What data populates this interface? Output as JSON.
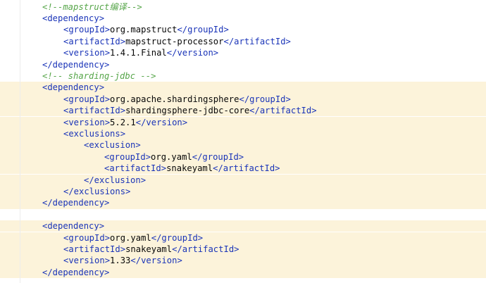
{
  "editor": {
    "colors": {
      "tag": "#1a34b8",
      "text": "#080808",
      "comment": "#57a64a",
      "highlight": "#fcf3da"
    },
    "lines": [
      {
        "highlight": false,
        "parts": [
          {
            "t": "cm",
            "v": "<!--mapstruct编译-->"
          }
        ]
      },
      {
        "highlight": false,
        "parts": [
          {
            "t": "tag",
            "v": "<dependency>"
          }
        ]
      },
      {
        "highlight": false,
        "parts": [
          {
            "t": "tag",
            "v": "<groupId>"
          },
          {
            "t": "txt",
            "v": "org.mapstruct"
          },
          {
            "t": "tag",
            "v": "</groupId>"
          }
        ]
      },
      {
        "highlight": false,
        "parts": [
          {
            "t": "tag",
            "v": "<artifactId>"
          },
          {
            "t": "txt",
            "v": "mapstruct-processor"
          },
          {
            "t": "tag",
            "v": "</artifactId>"
          }
        ]
      },
      {
        "highlight": false,
        "parts": [
          {
            "t": "tag",
            "v": "<version>"
          },
          {
            "t": "txt",
            "v": "1.4.1.Final"
          },
          {
            "t": "tag",
            "v": "</version>"
          }
        ]
      },
      {
        "highlight": false,
        "parts": [
          {
            "t": "tag",
            "v": "</dependency>"
          }
        ]
      },
      {
        "highlight": false,
        "parts": [
          {
            "t": "cm",
            "v": "<!-- sharding-jdbc -->"
          }
        ]
      },
      {
        "highlight": true,
        "parts": [
          {
            "t": "tag",
            "v": "<dependency>"
          }
        ]
      },
      {
        "highlight": true,
        "parts": [
          {
            "t": "tag",
            "v": "<groupId>"
          },
          {
            "t": "txt",
            "v": "org.apache.shardingsphere"
          },
          {
            "t": "tag",
            "v": "</groupId>"
          }
        ]
      },
      {
        "highlight": true,
        "parts": [
          {
            "t": "tag",
            "v": "<artifactId>"
          },
          {
            "t": "txt",
            "v": "shardingsphere-jdbc-core"
          },
          {
            "t": "tag",
            "v": "</artifactId>"
          }
        ]
      },
      {
        "highlight": true,
        "parts": [
          {
            "t": "tag",
            "v": "<version>"
          },
          {
            "t": "txt",
            "v": "5.2.1"
          },
          {
            "t": "tag",
            "v": "</version>"
          }
        ]
      },
      {
        "highlight": true,
        "parts": [
          {
            "t": "tag",
            "v": "<exclusions>"
          }
        ]
      },
      {
        "highlight": true,
        "parts": [
          {
            "t": "tag",
            "v": "<exclusion>"
          }
        ]
      },
      {
        "highlight": true,
        "parts": [
          {
            "t": "tag",
            "v": "<groupId>"
          },
          {
            "t": "txt",
            "v": "org.yaml"
          },
          {
            "t": "tag",
            "v": "</groupId>"
          }
        ]
      },
      {
        "highlight": true,
        "parts": [
          {
            "t": "tag",
            "v": "<artifactId>"
          },
          {
            "t": "txt",
            "v": "snakeyaml"
          },
          {
            "t": "tag",
            "v": "</artifactId>"
          }
        ]
      },
      {
        "highlight": true,
        "parts": [
          {
            "t": "tag",
            "v": "</exclusion>"
          }
        ]
      },
      {
        "highlight": true,
        "parts": [
          {
            "t": "tag",
            "v": "</exclusions>"
          }
        ]
      },
      {
        "highlight": true,
        "parts": [
          {
            "t": "tag",
            "v": "</dependency>"
          }
        ]
      },
      {
        "highlight": false,
        "parts": []
      },
      {
        "highlight": true,
        "parts": [
          {
            "t": "tag",
            "v": "<dependency>"
          }
        ]
      },
      {
        "highlight": true,
        "parts": [
          {
            "t": "tag",
            "v": "<groupId>"
          },
          {
            "t": "txt",
            "v": "org.yaml"
          },
          {
            "t": "tag",
            "v": "</groupId>"
          }
        ]
      },
      {
        "highlight": true,
        "parts": [
          {
            "t": "tag",
            "v": "<artifactId>"
          },
          {
            "t": "txt",
            "v": "snakeyaml"
          },
          {
            "t": "tag",
            "v": "</artifactId>"
          }
        ]
      },
      {
        "highlight": true,
        "parts": [
          {
            "t": "tag",
            "v": "<version>"
          },
          {
            "t": "txt",
            "v": "1.33"
          },
          {
            "t": "tag",
            "v": "</version>"
          }
        ]
      },
      {
        "highlight": true,
        "parts": [
          {
            "t": "tag",
            "v": "</dependency>"
          }
        ]
      }
    ]
  }
}
